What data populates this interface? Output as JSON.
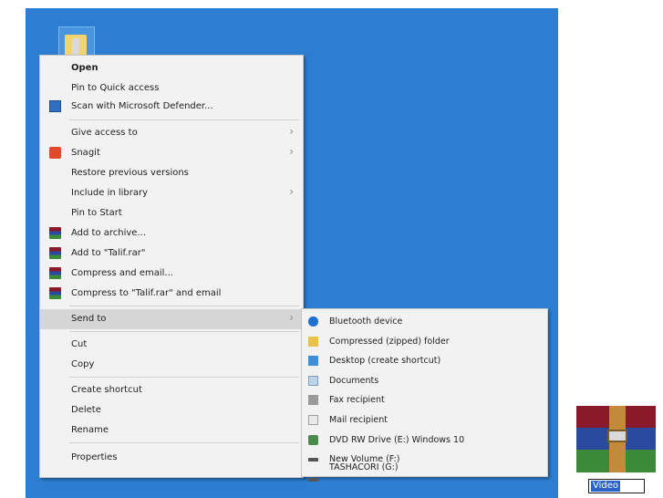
{
  "desktop_icon": {
    "name": "folder-icon"
  },
  "context_menu": {
    "items": [
      {
        "label": "Open",
        "bold": true
      },
      {
        "label": "Pin to Quick access"
      },
      {
        "label": "Scan with Microsoft Defender...",
        "icon": "defender-icon"
      },
      {
        "label": "Give access to",
        "submenu": true
      },
      {
        "label": "Snagit",
        "icon": "snagit-icon",
        "submenu": true
      },
      {
        "label": "Restore previous versions"
      },
      {
        "label": "Include in library",
        "submenu": true
      },
      {
        "label": "Pin to Start"
      },
      {
        "label": "Add to archive...",
        "icon": "winrar-icon"
      },
      {
        "label": "Add to \"Talif.rar\"",
        "icon": "winrar-icon"
      },
      {
        "label": "Compress and email...",
        "icon": "winrar-icon"
      },
      {
        "label": "Compress to \"Talif.rar\" and email",
        "icon": "winrar-icon"
      },
      {
        "label": "Send to",
        "submenu": true,
        "highlighted": true
      },
      {
        "label": "Cut"
      },
      {
        "label": "Copy"
      },
      {
        "label": "Create shortcut"
      },
      {
        "label": "Delete"
      },
      {
        "label": "Rename"
      },
      {
        "label": "Properties"
      }
    ]
  },
  "send_to_menu": {
    "items": [
      {
        "label": "Bluetooth device",
        "icon": "bluetooth-icon"
      },
      {
        "label": "Compressed (zipped) folder",
        "icon": "zip-folder-icon"
      },
      {
        "label": "Desktop (create shortcut)",
        "icon": "desktop-icon"
      },
      {
        "label": "Documents",
        "icon": "documents-icon"
      },
      {
        "label": "Fax recipient",
        "icon": "fax-icon"
      },
      {
        "label": "Mail recipient",
        "icon": "mail-icon"
      },
      {
        "label": "DVD RW Drive (E:) Windows 10",
        "icon": "dvd-drive-icon"
      },
      {
        "label": "New Volume (F:)",
        "icon": "drive-icon"
      },
      {
        "label": "TASHACORI (G:)",
        "icon": "drive-icon"
      }
    ]
  },
  "rar_file": {
    "icon": "winrar-archive-icon",
    "rename_value": "Video"
  },
  "colors": {
    "desktop": "#2d7ed2",
    "menu_bg": "#f2f2f2",
    "highlight": "#d6d6d6",
    "selection": "#2a64c8"
  }
}
